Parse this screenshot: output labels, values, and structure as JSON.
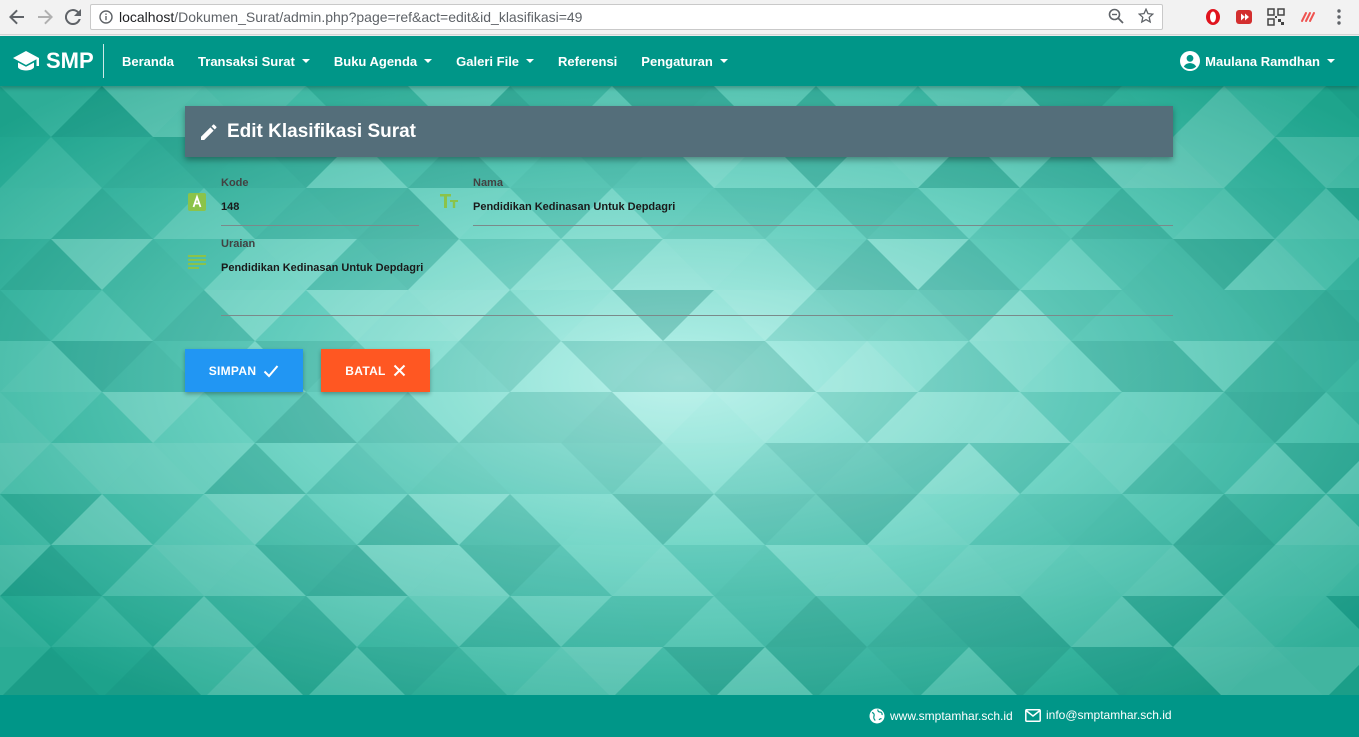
{
  "browser": {
    "url_host": "localhost",
    "url_path": "/Dokumen_Surat/admin.php?page=ref&act=edit&id_klasifikasi=49"
  },
  "navbar": {
    "brand": "SMP",
    "menu": [
      {
        "label": "Beranda",
        "dropdown": false
      },
      {
        "label": "Transaksi Surat",
        "dropdown": true
      },
      {
        "label": "Buku Agenda",
        "dropdown": true
      },
      {
        "label": "Galeri File",
        "dropdown": true
      },
      {
        "label": "Referensi",
        "dropdown": false
      },
      {
        "label": "Pengaturan",
        "dropdown": true
      }
    ],
    "user": "Maulana Ramdhan"
  },
  "form": {
    "title": "Edit Klasifikasi Surat",
    "kode": {
      "label": "Kode",
      "value": "148"
    },
    "nama": {
      "label": "Nama",
      "value": "Pendidikan Kedinasan Untuk Depdagri"
    },
    "uraian": {
      "label": "Uraian",
      "value": "Pendidikan Kedinasan Untuk Depdagri"
    },
    "simpan_label": "SIMPAN",
    "batal_label": "BATAL"
  },
  "footer": {
    "website": "www.smptamhar.sch.id",
    "email": "info@smptamhar.sch.id"
  },
  "colors": {
    "primary": "#009688",
    "header_card": "#546e7a",
    "simpan": "#2196f3",
    "batal": "#ff5722",
    "field_icon": "#8bc34a"
  },
  "icons": [
    "back-icon",
    "forward-icon",
    "reload-icon",
    "info-icon",
    "zoom-icon",
    "star-icon",
    "opera-icon",
    "video-icon",
    "qr-icon",
    "extension-icon",
    "menu-dots-icon",
    "graduation-cap-icon",
    "account-circle-icon",
    "pencil-icon",
    "code-icon",
    "text-fields-icon",
    "subject-icon",
    "check-icon",
    "close-icon",
    "globe-icon",
    "mail-icon"
  ]
}
